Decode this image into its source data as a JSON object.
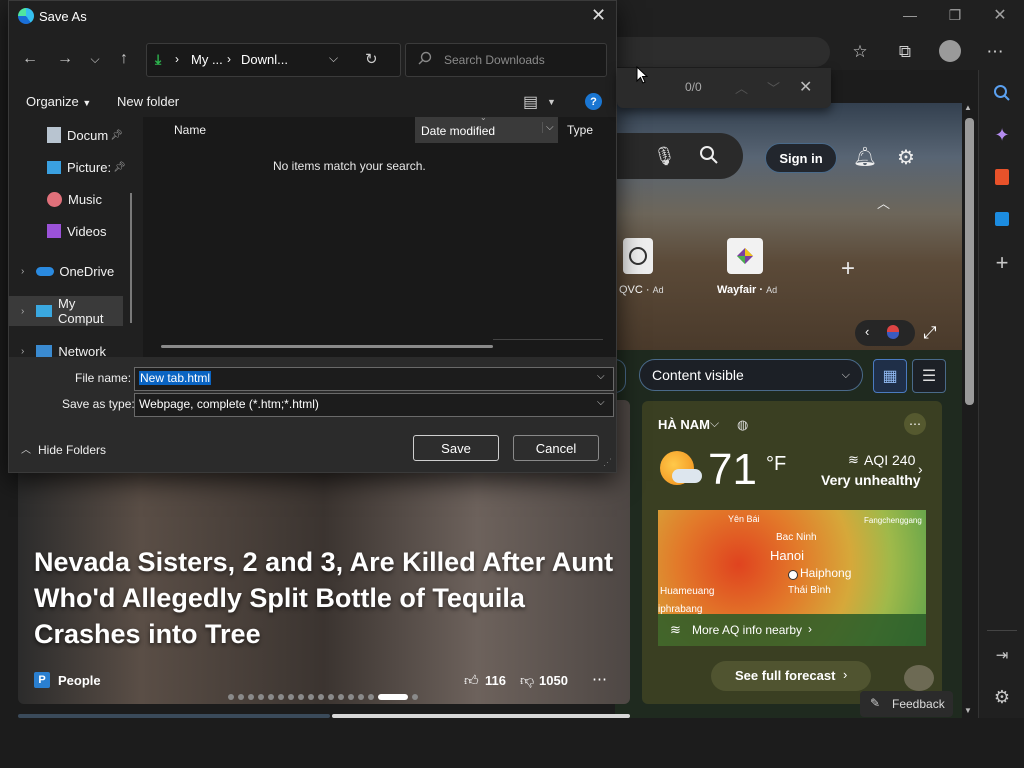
{
  "dialog": {
    "title": "Save As",
    "breadcrumb": [
      "My ...",
      "Downl..."
    ],
    "search_placeholder": "Search Downloads",
    "organize_label": "Organize",
    "new_folder_label": "New folder",
    "columns": {
      "name": "Name",
      "date_modified": "Date modified",
      "type": "Type"
    },
    "empty_message": "No items match your search.",
    "tree_items": [
      "Docum",
      "Picture:",
      "Music",
      "Videos",
      "OneDrive",
      "My Comput",
      "Network"
    ],
    "file_name_label": "File name:",
    "file_name_value": "New tab.html",
    "save_type_label": "Save as type:",
    "save_type_value": "Webpage, complete (*.htm;*.html)",
    "hide_folders_label": "Hide Folders",
    "save_label": "Save",
    "cancel_label": "Cancel"
  },
  "find_bar": {
    "count": "0/0"
  },
  "newtab": {
    "sign_in_label": "Sign in",
    "tiles": [
      {
        "name": "QVC",
        "ad": "Ad"
      },
      {
        "name": "Wayfair",
        "ad": "Ad"
      }
    ],
    "content_visible_label": "Content visible"
  },
  "news": {
    "headline": "Nevada Sisters, 2 and 3, Are Killed After Aunt Who'd Allegedly Split Bottle of Tequila Crashes into Tree",
    "source": "People",
    "likes": "116",
    "dislikes": "1050"
  },
  "weather": {
    "location": "HÀ NAM",
    "temperature": "71",
    "unit": "°F",
    "aqi": "AQI 240",
    "aqi_status": "Very unhealthy",
    "map_labels": {
      "yen_bai": "Yên Bái",
      "fangchenggang": "Fangchenggang",
      "bac_ninh": "Bac Ninh",
      "hanoi": "Hanoi",
      "haiphong": "Haiphong",
      "thai_binh": "Thái Bình",
      "huameuang": "Huameuang",
      "phrabang": "iphrabang"
    },
    "more_aq_label": "More AQ info nearby",
    "forecast_label": "See full forecast"
  },
  "feedback_label": "Feedback",
  "colors": {
    "accent": "#0078d4",
    "selection": "#0a64c2",
    "dialog_bg": "#202020",
    "download_arrow": "#2db84f"
  }
}
